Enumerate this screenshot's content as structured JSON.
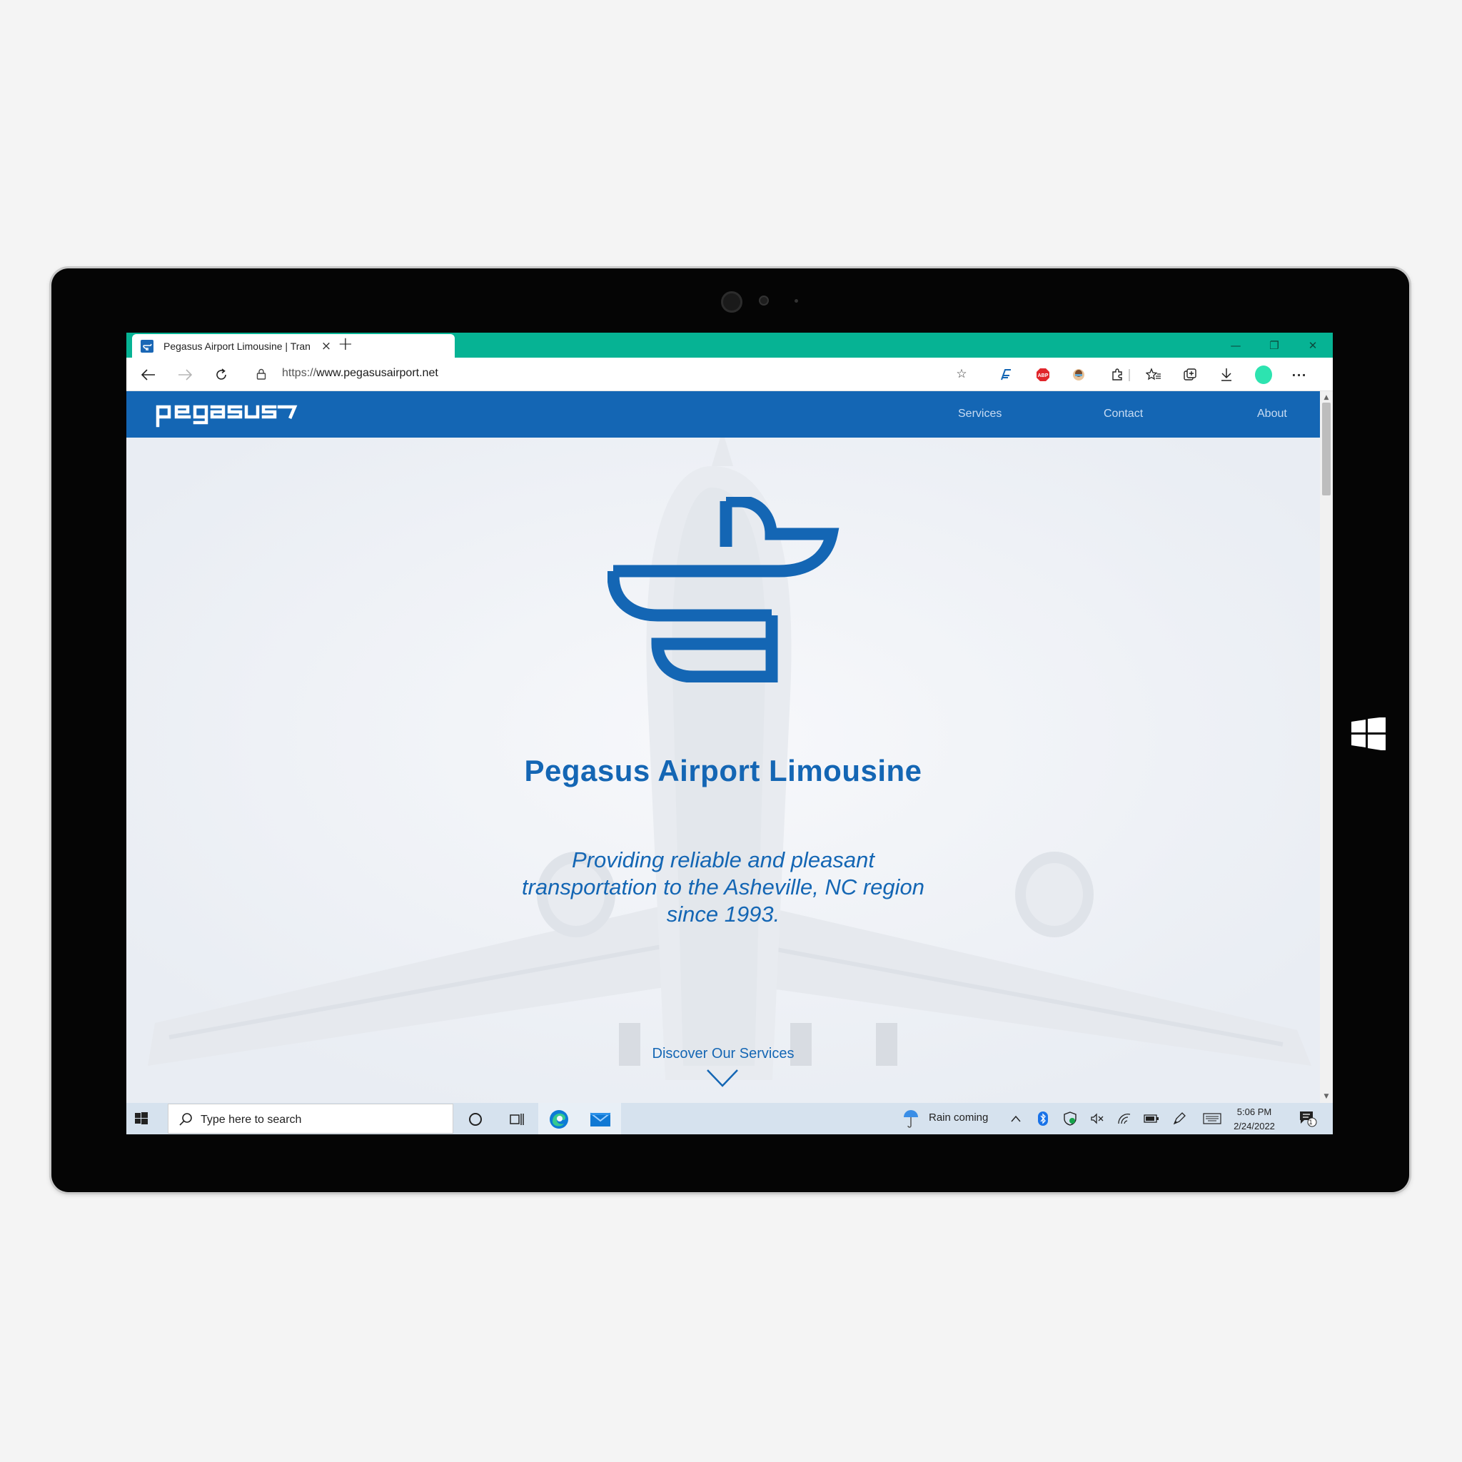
{
  "browser": {
    "tab_title": "Pegasus Airport Limousine | Tran",
    "new_tab": "+",
    "tab_close": "×",
    "url_protocol": "https://",
    "url_host": "www.pegasusairport.net",
    "window_controls": {
      "minimize": "—",
      "restore": "❐",
      "close": "✕"
    },
    "accent_color": "#06b394"
  },
  "site": {
    "logo_text": "pegasus",
    "nav": [
      {
        "label": "Services"
      },
      {
        "label": "Contact"
      },
      {
        "label": "About"
      }
    ],
    "hero_title": "Pegasus Airport Limousine",
    "hero_subtitle": "Providing reliable and pleasant transportation to the Asheville, NC region since 1993.",
    "discover_label": "Discover Our Services",
    "brand_color": "#1466b4"
  },
  "taskbar": {
    "search_placeholder": "Type here to search",
    "weather": "Rain coming",
    "time": "5:06 PM",
    "date": "2/24/2022",
    "notification_count": "1"
  }
}
